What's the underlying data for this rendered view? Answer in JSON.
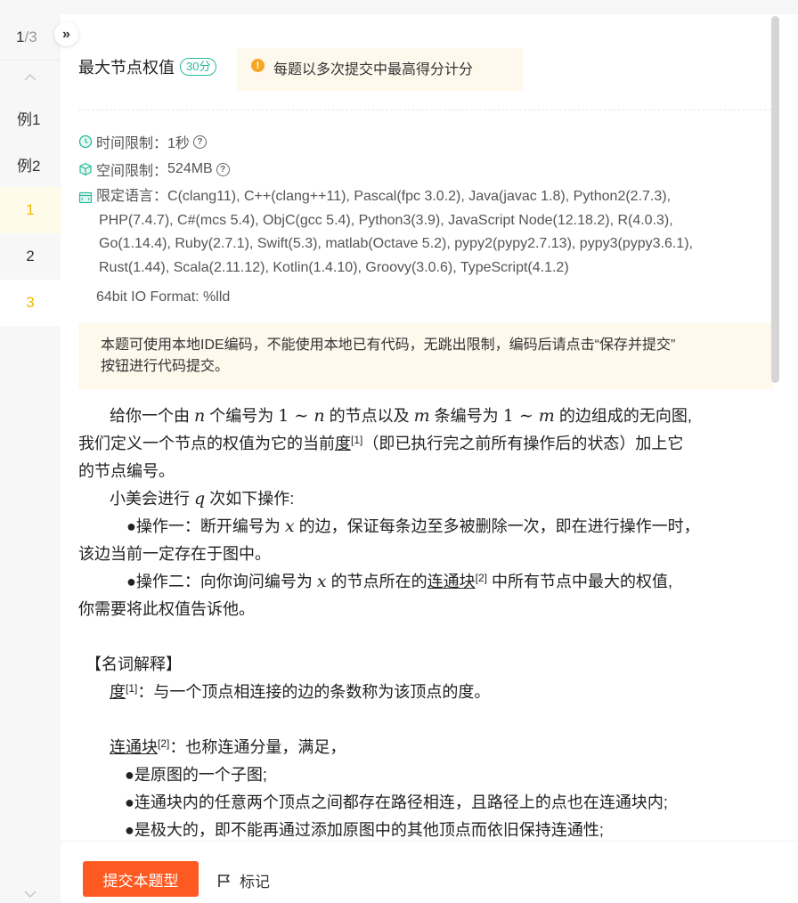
{
  "sidebar": {
    "current": "1",
    "total": "/3",
    "items": [
      {
        "label": "例1"
      },
      {
        "label": "例2"
      },
      {
        "label": "1"
      },
      {
        "label": "2"
      },
      {
        "label": "3"
      }
    ]
  },
  "header": {
    "title": "最大节点权值",
    "score": "30分",
    "notice": "每题以多次提交中最高得分计分"
  },
  "meta": {
    "time_label": "时间限制：",
    "time_value": "1秒",
    "space_label": "空间限制：",
    "space_value": "524MB",
    "lang_label": "限定语言：",
    "lang_line1": "C(clang11), C++(clang++11), Pascal(fpc 3.0.2), Java(javac 1.8), Python2(2.7.3),",
    "lang_line2": "PHP(7.4.7), C#(mcs 5.4), ObjC(gcc 5.4), Python3(3.9), JavaScript Node(12.18.2), R(4.0.3),",
    "lang_line3": "Go(1.14.4), Ruby(2.7.1), Swift(5.3), matlab(Octave 5.2), pypy2(pypy2.7.13), pypy3(pypy3.6.1),",
    "lang_line4": "Rust(1.44), Scala(2.11.12), Kotlin(1.4.10), Groovy(3.0.6), TypeScript(4.1.2)",
    "io_format": "64bit IO Format: %lld"
  },
  "ide_notice": {
    "line1": "本题可使用本地IDE编码，不能使用本地已有代码，无跳出限制，编码后请点击“保存并提交”",
    "line2": "按钮进行代码提交。"
  },
  "problem": {
    "p1_a": "给你一个由 ",
    "var_n": "n",
    "p1_b": " 个编号为 ",
    "range_1n_a": "1 ∼ ",
    "p1_c": " 的节点以及 ",
    "var_m": "m",
    "p1_d": " 条编号为 ",
    "range_1m_a": "1 ∼ ",
    "p1_e": " 的边组成的无向图,",
    "p2_a": "我们定义一个节点的权值为它的当前",
    "term_degree": "度",
    "ref1": "[1]",
    "p2_b": "（即已执行完之前所有操作后的状态）加上它",
    "p3": "的节点编号。",
    "p4_a": "小美会进行 ",
    "var_q": "q",
    "p4_b": " 次如下操作:",
    "op1_a": "●操作一：断开编号为 ",
    "var_x": "x",
    "op1_b": " 的边，保证每条边至多被删除一次，即在进行操作一时，",
    "op1_c": "该边当前一定存在于图中。",
    "op2_a": "●操作二：向你询问编号为 ",
    "op2_b": " 的节点所在的",
    "term_cc": "连通块",
    "ref2": "[2]",
    "op2_c": " 中所有节点中最大的权值,",
    "op2_d": "你需要将此权值告诉他。",
    "glossary_title": "【名词解释】",
    "def1_b": "：与一个顶点相连接的边的条数称为该顶点的度。",
    "def2_b": "：也称连通分量，满足，",
    "bullet1": "●是原图的一个子图;",
    "bullet2": "●连通块内的任意两个顶点之间都存在路径相连，且路径上的点也在连通块内;",
    "bullet3": "●是极大的，即不能再通过添加原图中的其他顶点而依旧保持连通性;"
  },
  "footer": {
    "submit_label": "提交本题型",
    "mark_label": "标记"
  },
  "colors": {
    "accent": "#fd5a21",
    "score": "#25bb9b",
    "sidebar_highlight": "#f5b800",
    "notice_bg": "#fff8ed"
  }
}
